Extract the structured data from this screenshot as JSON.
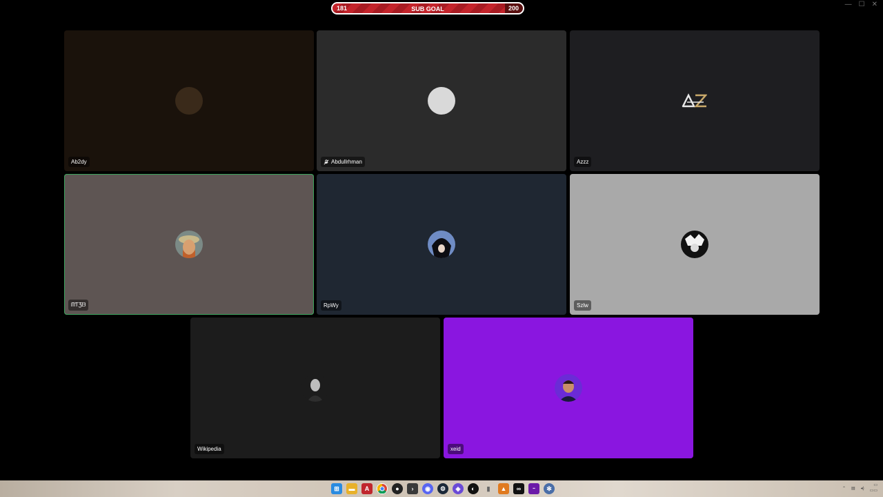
{
  "subgoal": {
    "current": "181",
    "title": "SUB GOAL",
    "target": "200",
    "progress": 0.905
  },
  "tiles": [
    {
      "name": "Ab2dy",
      "bg": "#1a120b",
      "muted": false,
      "speaking": false,
      "avatar_color": "#3a2a1a"
    },
    {
      "name": "Abdullrhman",
      "bg": "#2b2b2b",
      "muted": true,
      "speaking": false,
      "avatar_color": "#d9d9d9"
    },
    {
      "name": "Azzz",
      "bg": "#1e1e21",
      "muted": false,
      "speaking": false,
      "avatar_color": "#1e1e21"
    },
    {
      "name": "ᗰƬƷᗷ",
      "bg": "#5e5553",
      "muted": false,
      "speaking": true,
      "avatar_color": "#a87d4f"
    },
    {
      "name": "RpWy",
      "bg": "#1f2732",
      "muted": false,
      "speaking": false,
      "avatar_color": "#2b3c5a"
    },
    {
      "name": "Szlw",
      "bg": "#a9a9a9",
      "muted": false,
      "speaking": false,
      "avatar_color": "#111111"
    },
    {
      "name": "Wikipedia",
      "bg": "#1c1c1c",
      "muted": false,
      "speaking": false,
      "avatar_color": "#333333"
    },
    {
      "name": "xeid",
      "bg": "#8a16e0",
      "muted": false,
      "speaking": false,
      "avatar_color": "#221a40"
    }
  ],
  "taskbar": {
    "icons": [
      "windows-icon",
      "file-explorer-icon",
      "app-a-icon",
      "chrome-icon",
      "github-icon",
      "terminal-icon",
      "discord-icon",
      "steam-icon",
      "app-purple-icon",
      "app-circle-icon",
      "mouse-icon",
      "app-flame-icon",
      "app-black-icon",
      "app-next-icon",
      "settings-icon"
    ]
  }
}
